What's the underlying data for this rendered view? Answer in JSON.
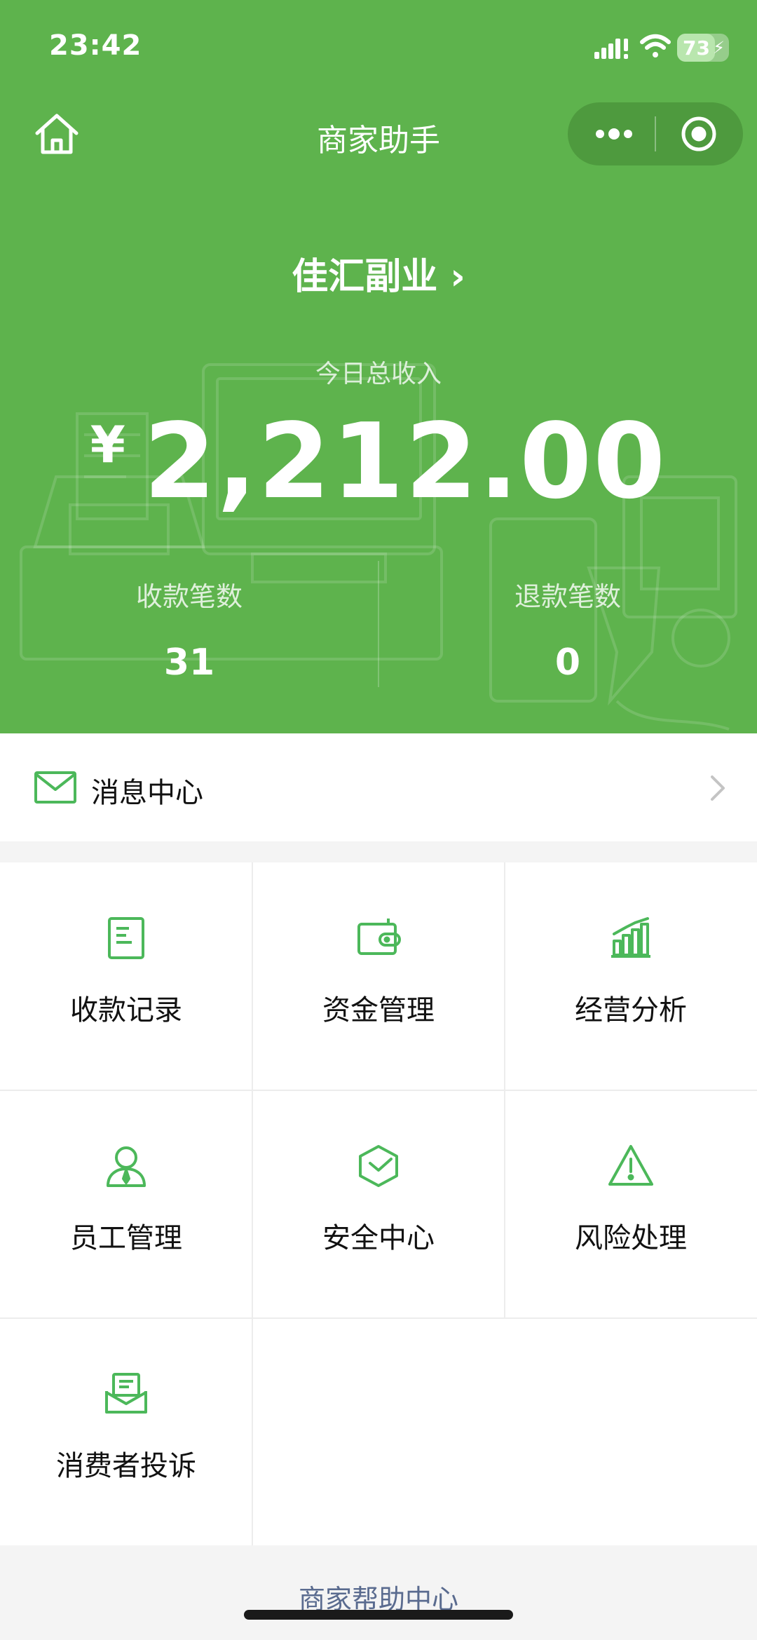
{
  "status_bar": {
    "time": "23:42",
    "battery": "73",
    "battery_level": 0.73
  },
  "navbar": {
    "title": "商家助手"
  },
  "merchant": {
    "name": "佳汇副业 ›"
  },
  "income": {
    "label": "今日总收入",
    "currency": "¥",
    "amount": "2,212.00"
  },
  "stats": [
    {
      "label": "收款笔数",
      "value": "31"
    },
    {
      "label": "退款笔数",
      "value": "0"
    }
  ],
  "message_center": {
    "label": "消息中心"
  },
  "grid": [
    {
      "label": "收款记录",
      "icon": "receipt-icon"
    },
    {
      "label": "资金管理",
      "icon": "wallet-icon"
    },
    {
      "label": "经营分析",
      "icon": "bar-chart-icon"
    },
    {
      "label": "员工管理",
      "icon": "staff-icon"
    },
    {
      "label": "安全中心",
      "icon": "shield-icon"
    },
    {
      "label": "风险处理",
      "icon": "warning-icon"
    },
    {
      "label": "消费者投诉",
      "icon": "complaint-icon"
    }
  ],
  "footer": {
    "help_link": "商家帮助中心"
  },
  "colors": {
    "brand_green": "#5eb34d",
    "icon_green": "#4cb85a",
    "link": "#5a6b8f"
  }
}
